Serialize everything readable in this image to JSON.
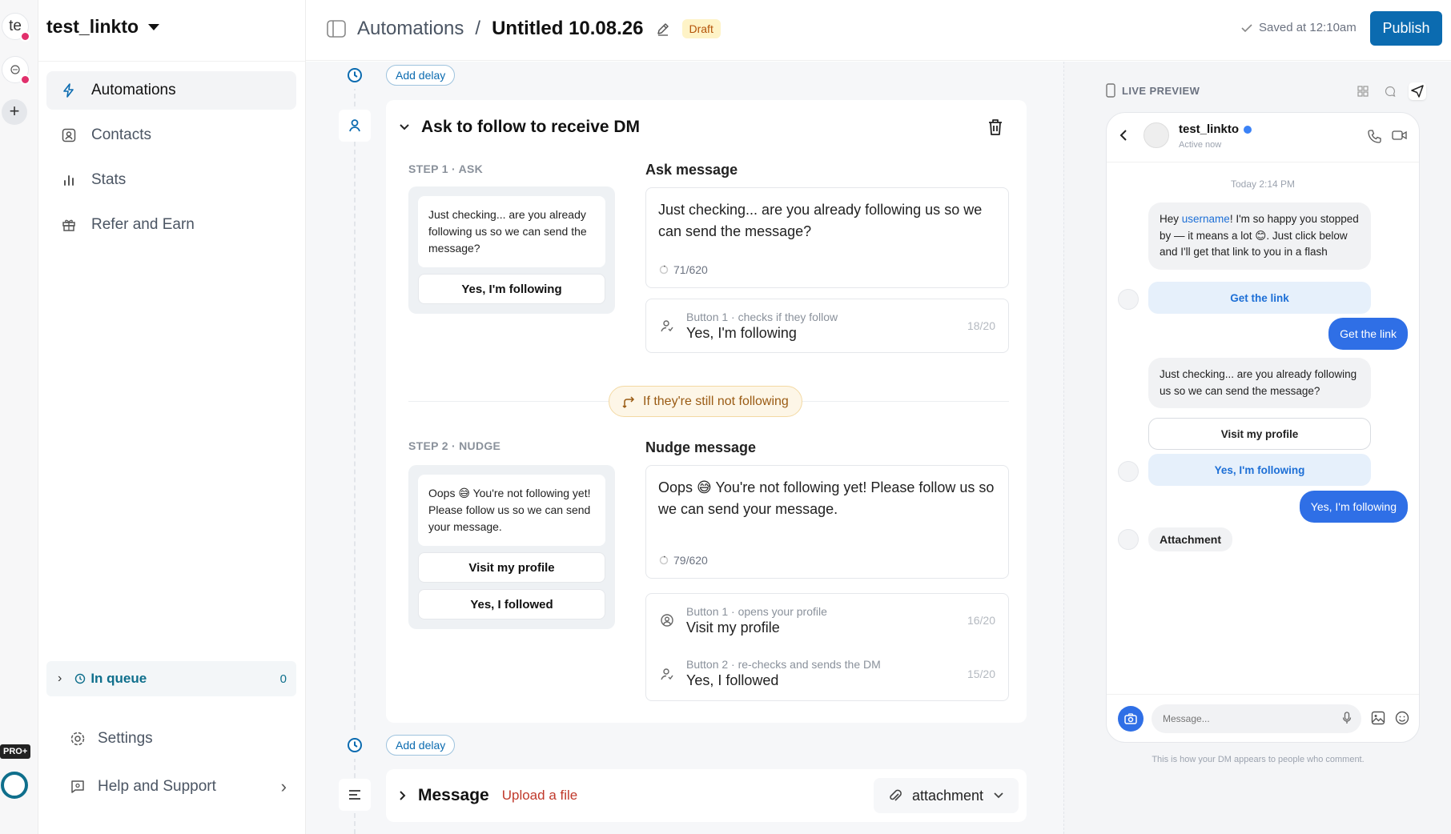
{
  "rail": {
    "account1_initials": "te",
    "add_label": "+",
    "pro_badge": "PRO+"
  },
  "sidebar": {
    "workspace": "test_linkto",
    "items": [
      {
        "label": "Automations",
        "icon": "bolt-icon"
      },
      {
        "label": "Contacts",
        "icon": "contact-card-icon"
      },
      {
        "label": "Stats",
        "icon": "bar-chart-icon"
      },
      {
        "label": "Refer and Earn",
        "icon": "gift-icon"
      }
    ],
    "queue": {
      "label": "In queue",
      "count": "0"
    },
    "settings": "Settings",
    "help": "Help and Support"
  },
  "header": {
    "section": "Automations",
    "separator": "/",
    "title": "Untitled 10.08.26",
    "status": "Draft",
    "saved": "Saved at 12:10am",
    "publish": "Publish"
  },
  "canvas": {
    "add_delay": "Add delay",
    "card_title": "Ask to follow to receive DM",
    "step1": {
      "label": "STEP 1 · ASK",
      "preview_text": "Just checking... are you already following us so we can send the message?",
      "preview_buttons": [
        "Yes, I'm following"
      ],
      "message_label": "Ask message",
      "message": "Just checking... are you already following us so we can send the message?",
      "counter": "71/620",
      "buttons": [
        {
          "meta": "Button 1 · checks if they follow",
          "text": "Yes, I'm following",
          "count": "18/20"
        }
      ]
    },
    "branch_label": "If they're still not following",
    "step2": {
      "label": "STEP 2 · NUDGE",
      "preview_text": "Oops 😅 You're not following yet! Please follow us so we can send your message.",
      "preview_buttons": [
        "Visit my profile",
        "Yes, I followed"
      ],
      "message_label": "Nudge message",
      "message": "Oops 😅 You're not following yet! Please follow us so we can send your message.",
      "counter": "79/620",
      "buttons": [
        {
          "meta": "Button 1 · opens your profile",
          "text": "Visit my profile",
          "count": "16/20"
        },
        {
          "meta": "Button 2 · re-checks and sends the DM",
          "text": "Yes, I followed",
          "count": "15/20"
        }
      ]
    },
    "message_block": {
      "title": "Message",
      "upload": "Upload a file",
      "type": "attachment"
    }
  },
  "preview": {
    "heading": "LIVE PREVIEW",
    "contact_name": "test_linkto",
    "contact_status": "Active now",
    "time": "Today 2:14 PM",
    "bubble1_a": "Hey ",
    "bubble1_link": "username",
    "bubble1_b": "! I'm so happy you stopped by — it means a lot 😊. Just click below and I'll get that link to you in a flash",
    "qr_get_link": "Get the link",
    "reply_get_link": "Get the link",
    "bubble2": "Just checking... are you already following us so we can send the message?",
    "qr_visit": "Visit my profile",
    "qr_following": "Yes, I'm following",
    "reply_following": "Yes, I'm following",
    "attachment": "Attachment",
    "input_placeholder": "Message...",
    "footnote": "This is how your DM appears to people who comment."
  }
}
